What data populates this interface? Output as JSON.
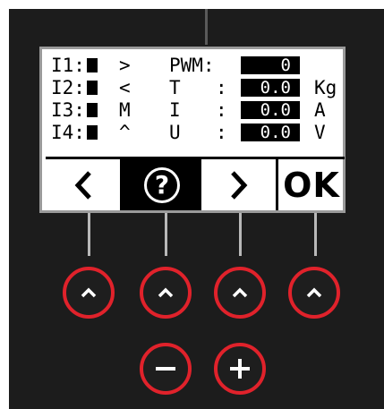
{
  "lcd": {
    "rows": [
      {
        "input": "I1:",
        "symbol": ">",
        "param": "PWM:",
        "colon": "",
        "value": "0",
        "unit": ""
      },
      {
        "input": "I2:",
        "symbol": "<",
        "param": "T",
        "colon": ":",
        "value": "0.0",
        "unit": "Kg"
      },
      {
        "input": "I3:",
        "symbol": "M",
        "param": "I",
        "colon": ":",
        "value": "0.0",
        "unit": "A"
      },
      {
        "input": "I4:",
        "symbol": "^",
        "param": "U",
        "colon": ":",
        "value": "0.0",
        "unit": "V"
      }
    ],
    "softkeys": {
      "prev_icon": "chevron-left-icon",
      "help_label": "?",
      "next_icon": "chevron-right-icon",
      "ok_label": "OK"
    }
  },
  "buttons": {
    "up_icon": "chevron-up-icon",
    "minus_icon": "minus-icon",
    "plus_icon": "plus-icon"
  },
  "colors": {
    "panel": "#1c1c1c",
    "accent_ring": "#e0222b",
    "lcd_background": "#ffffff"
  }
}
